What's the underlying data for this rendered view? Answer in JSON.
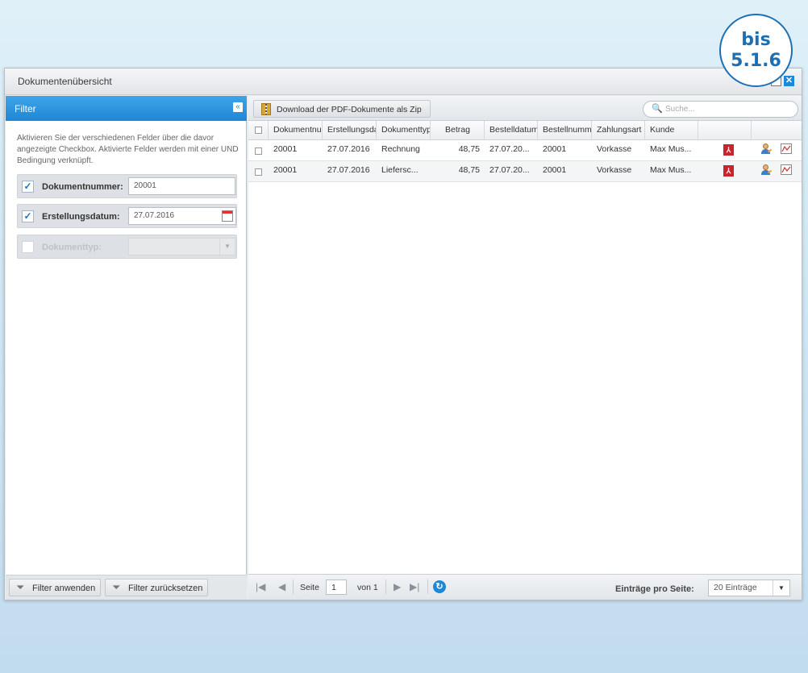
{
  "badge": {
    "line1": "bis",
    "line2": "5.1.6"
  },
  "window": {
    "title": "Dokumentenübersicht",
    "close_glyph": "✕"
  },
  "filter": {
    "header": "Filter",
    "collapse_glyph": "«",
    "info": "Aktivieren Sie der verschiedenen Felder über die davor angezeigte Checkbox. Aktivierte Felder werden mit einer UND Bedingung verknüpft.",
    "fields": [
      {
        "label": "Dokumentnummer:",
        "value": "20001",
        "checked": true
      },
      {
        "label": "Erstellungsdatum:",
        "value": "27.07.2016",
        "checked": true
      },
      {
        "label": "Dokumenttyp:",
        "value": "",
        "checked": false
      }
    ],
    "apply_label": "Filter anwenden",
    "reset_label": "Filter zurücksetzen"
  },
  "toolbar": {
    "zip_label": "Download der PDF-Dokumente als Zip",
    "search_placeholder": "Suche..."
  },
  "grid": {
    "columns": [
      "Dokumentnummer",
      "Erstellungsdatum",
      "Dokumenttyp",
      "Betrag",
      "Bestelldatum",
      "Bestellnummer",
      "Zahlungsart",
      "Kunde"
    ],
    "rows": [
      {
        "docnum": "20001",
        "created": "27.07.2016",
        "type": "Rechnung",
        "amount": "48,75",
        "orderdate": "27.07.20...",
        "ordernum": "20001",
        "payment": "Vorkasse",
        "customer": "Max Mus..."
      },
      {
        "docnum": "20001",
        "created": "27.07.2016",
        "type": "Liefersc...",
        "amount": "48,75",
        "orderdate": "27.07.20...",
        "ordernum": "20001",
        "payment": "Vorkasse",
        "customer": "Max Mus..."
      }
    ]
  },
  "pager": {
    "page_label": "Seite",
    "page_value": "1",
    "of_label": "von 1",
    "per_page_label": "Einträge pro Seite:",
    "per_page_value": "20 Einträge"
  },
  "colors": {
    "accent": "#1f86d3",
    "pdf": "#c9242b",
    "badge": "#1d6fb5"
  },
  "icons": [
    "funnel-icon",
    "funnel-reset-icon",
    "zip-icon",
    "search-icon",
    "pdf-icon",
    "edit-customer-icon",
    "chart-icon",
    "refresh-icon"
  ]
}
